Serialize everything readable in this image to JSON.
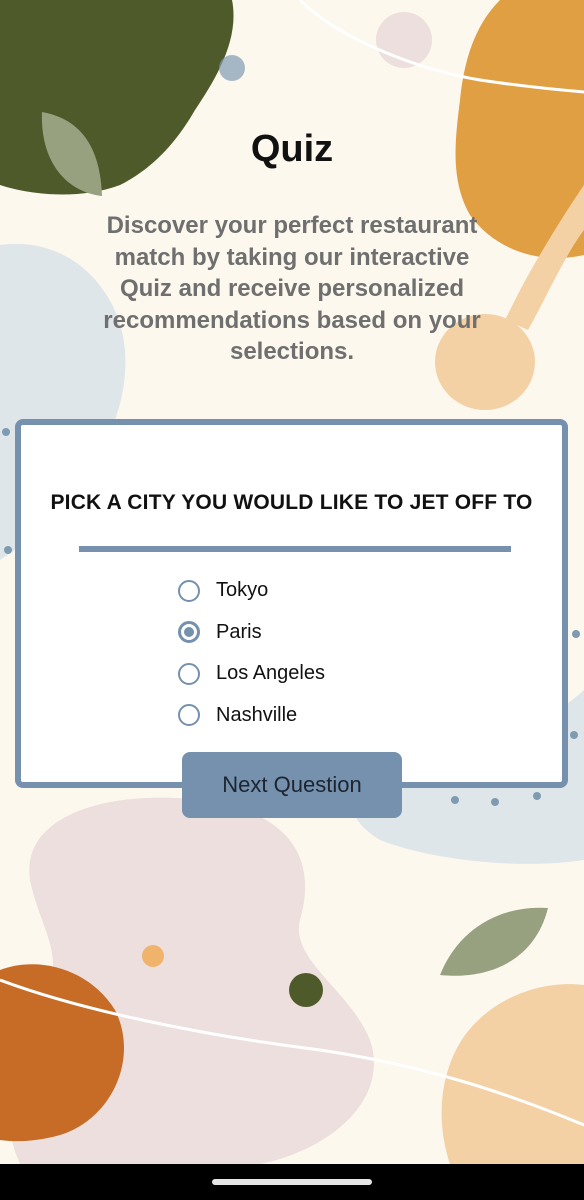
{
  "header": {
    "title": "Quiz",
    "description": "Discover your perfect restaurant match by taking our interactive Quiz and receive personalized recommendations based on your selections."
  },
  "quiz": {
    "question": "PICK A CITY YOU WOULD LIKE TO JET OFF TO",
    "options": [
      {
        "label": "Tokyo",
        "selected": false
      },
      {
        "label": "Paris",
        "selected": true
      },
      {
        "label": "Los Angeles",
        "selected": false
      },
      {
        "label": "Nashville",
        "selected": false
      }
    ],
    "next_label": "Next Question"
  },
  "colors": {
    "accent": "#7591ad",
    "background": "#fdf8ee",
    "olive": "#4f5a2b",
    "orange": "#e19f43",
    "rust": "#c76c27",
    "sage": "#97a17f",
    "peach": "#f3d1a5",
    "blush": "#ecdfdd",
    "mist": "#dfe6ea"
  }
}
